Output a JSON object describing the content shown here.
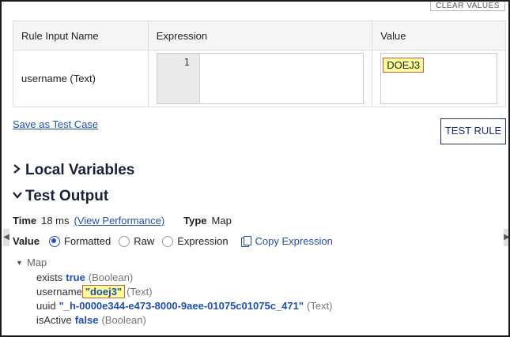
{
  "toolbar": {
    "clear_values": "CLEAR VALUES"
  },
  "rule_inputs": {
    "headers": {
      "name": "Rule Input Name",
      "expression": "Expression",
      "value": "Value"
    },
    "rows": [
      {
        "name": "username (Text)",
        "line_number": "1",
        "expression": "",
        "value": "DOEJ3"
      }
    ]
  },
  "actions": {
    "save_test_case": "Save as Test Case",
    "test_rule": "TEST RULE"
  },
  "sections": {
    "local_variables": "Local Variables",
    "test_output": "Test Output"
  },
  "output": {
    "time_label": "Time",
    "time_value": "18 ms",
    "view_performance": "(View Performance)",
    "type_label": "Type",
    "type_value": "Map",
    "value_label": "Value",
    "formats": [
      "Formatted",
      "Raw",
      "Expression"
    ],
    "selected_format": "Formatted",
    "copy_expression": "Copy Expression"
  },
  "result_tree": {
    "root": "Map",
    "items": [
      {
        "key": "exists",
        "value": "true",
        "type": "(Boolean)"
      },
      {
        "key": "username",
        "value": "\"doej3\"",
        "type": "(Text)"
      },
      {
        "key": "uuid",
        "value": "\"_h-0000e344-e473-8000-9aee-01075c01075c_471\"",
        "type": "(Text)"
      },
      {
        "key": "isActive",
        "value": "false",
        "type": "(Boolean)"
      }
    ]
  },
  "colors": {
    "accent": "#2850c8",
    "link": "#2150a8",
    "highlight": "#ffff99",
    "highlight_border": "#d9534f",
    "heading": "#1a1f3a"
  }
}
